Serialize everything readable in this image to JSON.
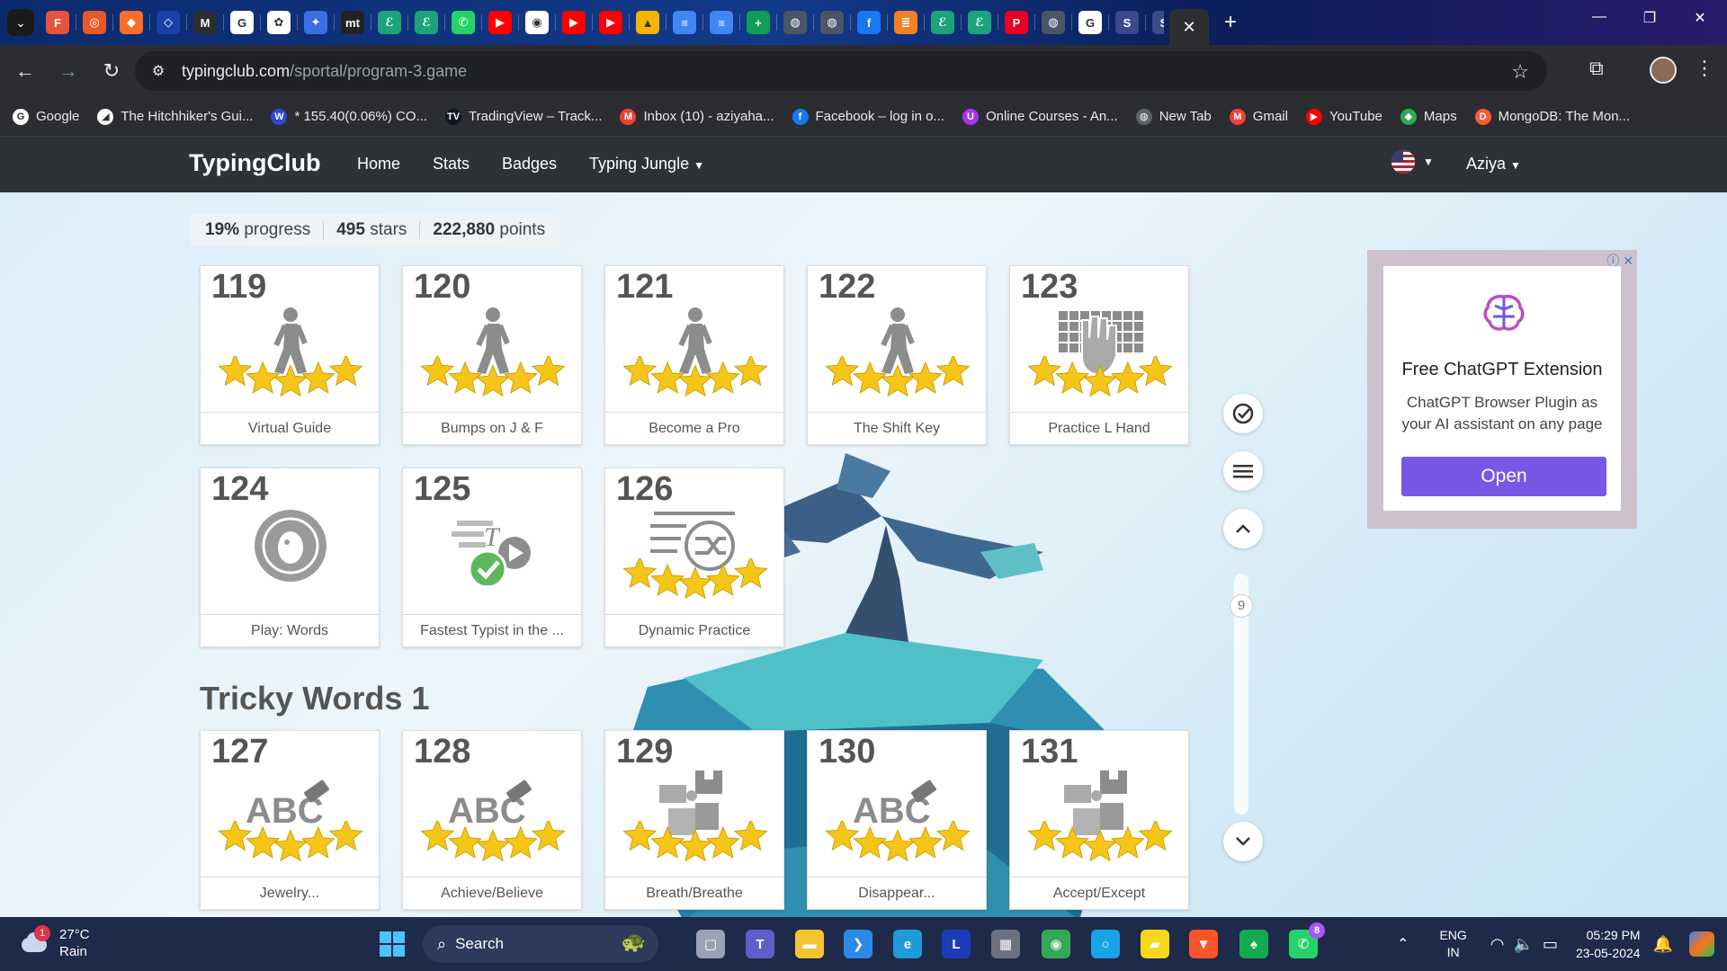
{
  "browser": {
    "tabs": [
      {
        "name": "figma",
        "color": "#e8543a",
        "glyph": "F"
      },
      {
        "name": "site",
        "color": "#e65a2a",
        "glyph": "◎"
      },
      {
        "name": "site",
        "color": "#ff6d2a",
        "glyph": "◆"
      },
      {
        "name": "site",
        "color": "#1c3fa8",
        "glyph": "◇"
      },
      {
        "name": "gmail",
        "color": "#2b2d31",
        "glyph": "M"
      },
      {
        "name": "google",
        "color": "#ffffff",
        "glyph": "G"
      },
      {
        "name": "chatgpt",
        "color": "#ffffff",
        "glyph": "✿"
      },
      {
        "name": "gemini",
        "color": "#3b6fe0",
        "glyph": "✦"
      },
      {
        "name": "mt",
        "color": "#222222",
        "glyph": "mt"
      },
      {
        "name": "site",
        "color": "#1ca37a",
        "glyph": "ℰ"
      },
      {
        "name": "site",
        "color": "#1ca37a",
        "glyph": "ℰ"
      },
      {
        "name": "whatsapp",
        "color": "#25d366",
        "glyph": "✆"
      },
      {
        "name": "youtube",
        "color": "#ff0000",
        "glyph": "▶"
      },
      {
        "name": "github",
        "color": "#ffffff",
        "glyph": "◉"
      },
      {
        "name": "youtube",
        "color": "#ff0000",
        "glyph": "▶"
      },
      {
        "name": "youtube",
        "color": "#ff0000",
        "glyph": "▶"
      },
      {
        "name": "drive",
        "color": "#f4b400",
        "glyph": "▲"
      },
      {
        "name": "docs",
        "color": "#4285f4",
        "glyph": "≡"
      },
      {
        "name": "docs",
        "color": "#4285f4",
        "glyph": "≡"
      },
      {
        "name": "sheets",
        "color": "#0f9d58",
        "glyph": "+"
      },
      {
        "name": "globe",
        "color": "#4a5568",
        "glyph": "◍"
      },
      {
        "name": "globe",
        "color": "#4a5568",
        "glyph": "◍"
      },
      {
        "name": "facebook",
        "color": "#1877f2",
        "glyph": "f"
      },
      {
        "name": "stackoverflow",
        "color": "#f48024",
        "glyph": "≣"
      },
      {
        "name": "site",
        "color": "#1ca37a",
        "glyph": "ℰ"
      },
      {
        "name": "site",
        "color": "#1ca37a",
        "glyph": "ℰ"
      },
      {
        "name": "pinterest",
        "color": "#e60023",
        "glyph": "P"
      },
      {
        "name": "globe",
        "color": "#4a5568",
        "glyph": "◍"
      },
      {
        "name": "google",
        "color": "#ffffff",
        "glyph": "G"
      },
      {
        "name": "site",
        "color": "#3a4a8a",
        "glyph": "S"
      },
      {
        "name": "site",
        "color": "#3a4a8a",
        "glyph": "S"
      },
      {
        "name": "site",
        "color": "#3a4a8a",
        "glyph": "S"
      },
      {
        "name": "site",
        "color": "#3a4a8a",
        "glyph": "S"
      },
      {
        "name": "site",
        "color": "#3a4a8a",
        "glyph": "S"
      },
      {
        "name": "site",
        "color": "#3a4a8a",
        "glyph": "S"
      },
      {
        "name": "site",
        "color": "#3a4a8a",
        "glyph": "S"
      },
      {
        "name": "site",
        "color": "#3a4a8a",
        "glyph": "S"
      },
      {
        "name": "site",
        "color": "#3a4a8a",
        "glyph": "S"
      }
    ],
    "url_host": "typingclub.com",
    "url_path": "/sportal/program-3.game",
    "bookmarks": [
      {
        "label": "Google",
        "color": "#ffffff",
        "glyph": "G"
      },
      {
        "label": "The Hitchhiker's Gui...",
        "color": "#ffffff",
        "glyph": "◢"
      },
      {
        "label": "* 155.40(0.06%) CO...",
        "color": "#2a4ad8",
        "glyph": "W"
      },
      {
        "label": "TradingView – Track...",
        "color": "#131722",
        "glyph": "TV"
      },
      {
        "label": "Inbox (10) - aziyaha...",
        "color": "#ea4335",
        "glyph": "M"
      },
      {
        "label": "Facebook – log in o...",
        "color": "#1877f2",
        "glyph": "f"
      },
      {
        "label": "Online Courses - An...",
        "color": "#a435f0",
        "glyph": "U"
      },
      {
        "label": "New Tab",
        "color": "#5f6368",
        "glyph": "◍"
      },
      {
        "label": "Gmail",
        "color": "#ea4335",
        "glyph": "M"
      },
      {
        "label": "YouTube",
        "color": "#ff0000",
        "glyph": "▶"
      },
      {
        "label": "Maps",
        "color": "#34a853",
        "glyph": "◆"
      },
      {
        "label": "MongoDB: The Mon...",
        "color": "#ff5a36",
        "glyph": "D"
      }
    ]
  },
  "site": {
    "brand": "TypingClub",
    "nav": [
      "Home",
      "Stats",
      "Badges",
      "Typing Jungle"
    ],
    "user": "Aziya"
  },
  "stats": {
    "progress_value": "19%",
    "progress_label": "progress",
    "stars_value": "495",
    "stars_label": "stars",
    "points_value": "222,880",
    "points_label": "points"
  },
  "lessons": [
    {
      "num": "119",
      "label": "Virtual Guide",
      "pic": "walker",
      "stars": 5
    },
    {
      "num": "120",
      "label": "Bumps on J & F",
      "pic": "walker",
      "stars": 5
    },
    {
      "num": "121",
      "label": "Become a Pro",
      "pic": "walker",
      "stars": 5
    },
    {
      "num": "122",
      "label": "The Shift Key",
      "pic": "walker",
      "stars": 5
    },
    {
      "num": "123",
      "label": "Practice L Hand",
      "pic": "keyboard",
      "stars": 5
    },
    {
      "num": "124",
      "label": "Play: Words",
      "pic": "game",
      "stars": 0
    },
    {
      "num": "125",
      "label": "Fastest Typist in the ...",
      "pic": "video",
      "stars": 0
    },
    {
      "num": "126",
      "label": "Dynamic Practice",
      "pic": "shuffle",
      "stars": 5
    }
  ],
  "section_title": "Tricky Words 1",
  "lessons2": [
    {
      "num": "127",
      "label": "Jewelry...",
      "pic": "abc",
      "stars": 5
    },
    {
      "num": "128",
      "label": "Achieve/Believe",
      "pic": "abc",
      "stars": 5
    },
    {
      "num": "129",
      "label": "Breath/Breathe",
      "pic": "puzzle",
      "stars": 5
    },
    {
      "num": "130",
      "label": "Disappear...",
      "pic": "abc",
      "stars": 5
    },
    {
      "num": "131",
      "label": "Accept/Except",
      "pic": "puzzle",
      "stars": 5
    }
  ],
  "side_controls": {
    "page": "9"
  },
  "ad": {
    "title": "Free ChatGPT Extension",
    "text": "ChatGPT Browser Plugin as your AI assistant on any page",
    "button": "Open"
  },
  "taskbar": {
    "weather_temp": "27°C",
    "weather_desc": "Rain",
    "weather_badge": "1",
    "search_label": "Search",
    "lang_top": "ENG",
    "lang_bottom": "IN",
    "time": "05:29 PM",
    "date": "23-05-2024",
    "whatsapp_badge": "8"
  },
  "colors": {
    "accent": "#7957e6",
    "star": "#f5c518",
    "nav_bg": "#2d3237"
  }
}
